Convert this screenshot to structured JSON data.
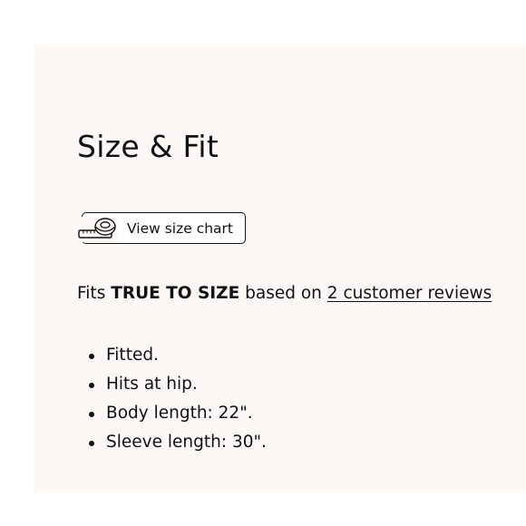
{
  "size_fit": {
    "title": "Size & Fit",
    "size_chart_button": {
      "label": "View size chart",
      "icon": "measuring-tape-icon"
    },
    "fit_summary": {
      "prefix": "Fits",
      "fit_value": "TRUE TO SIZE",
      "middle": "based on",
      "reviews_link": "2 customer reviews"
    },
    "details": [
      "Fitted.",
      "Hits at hip.",
      "Body length: 22\".",
      "Sleeve length: 30\"."
    ]
  }
}
